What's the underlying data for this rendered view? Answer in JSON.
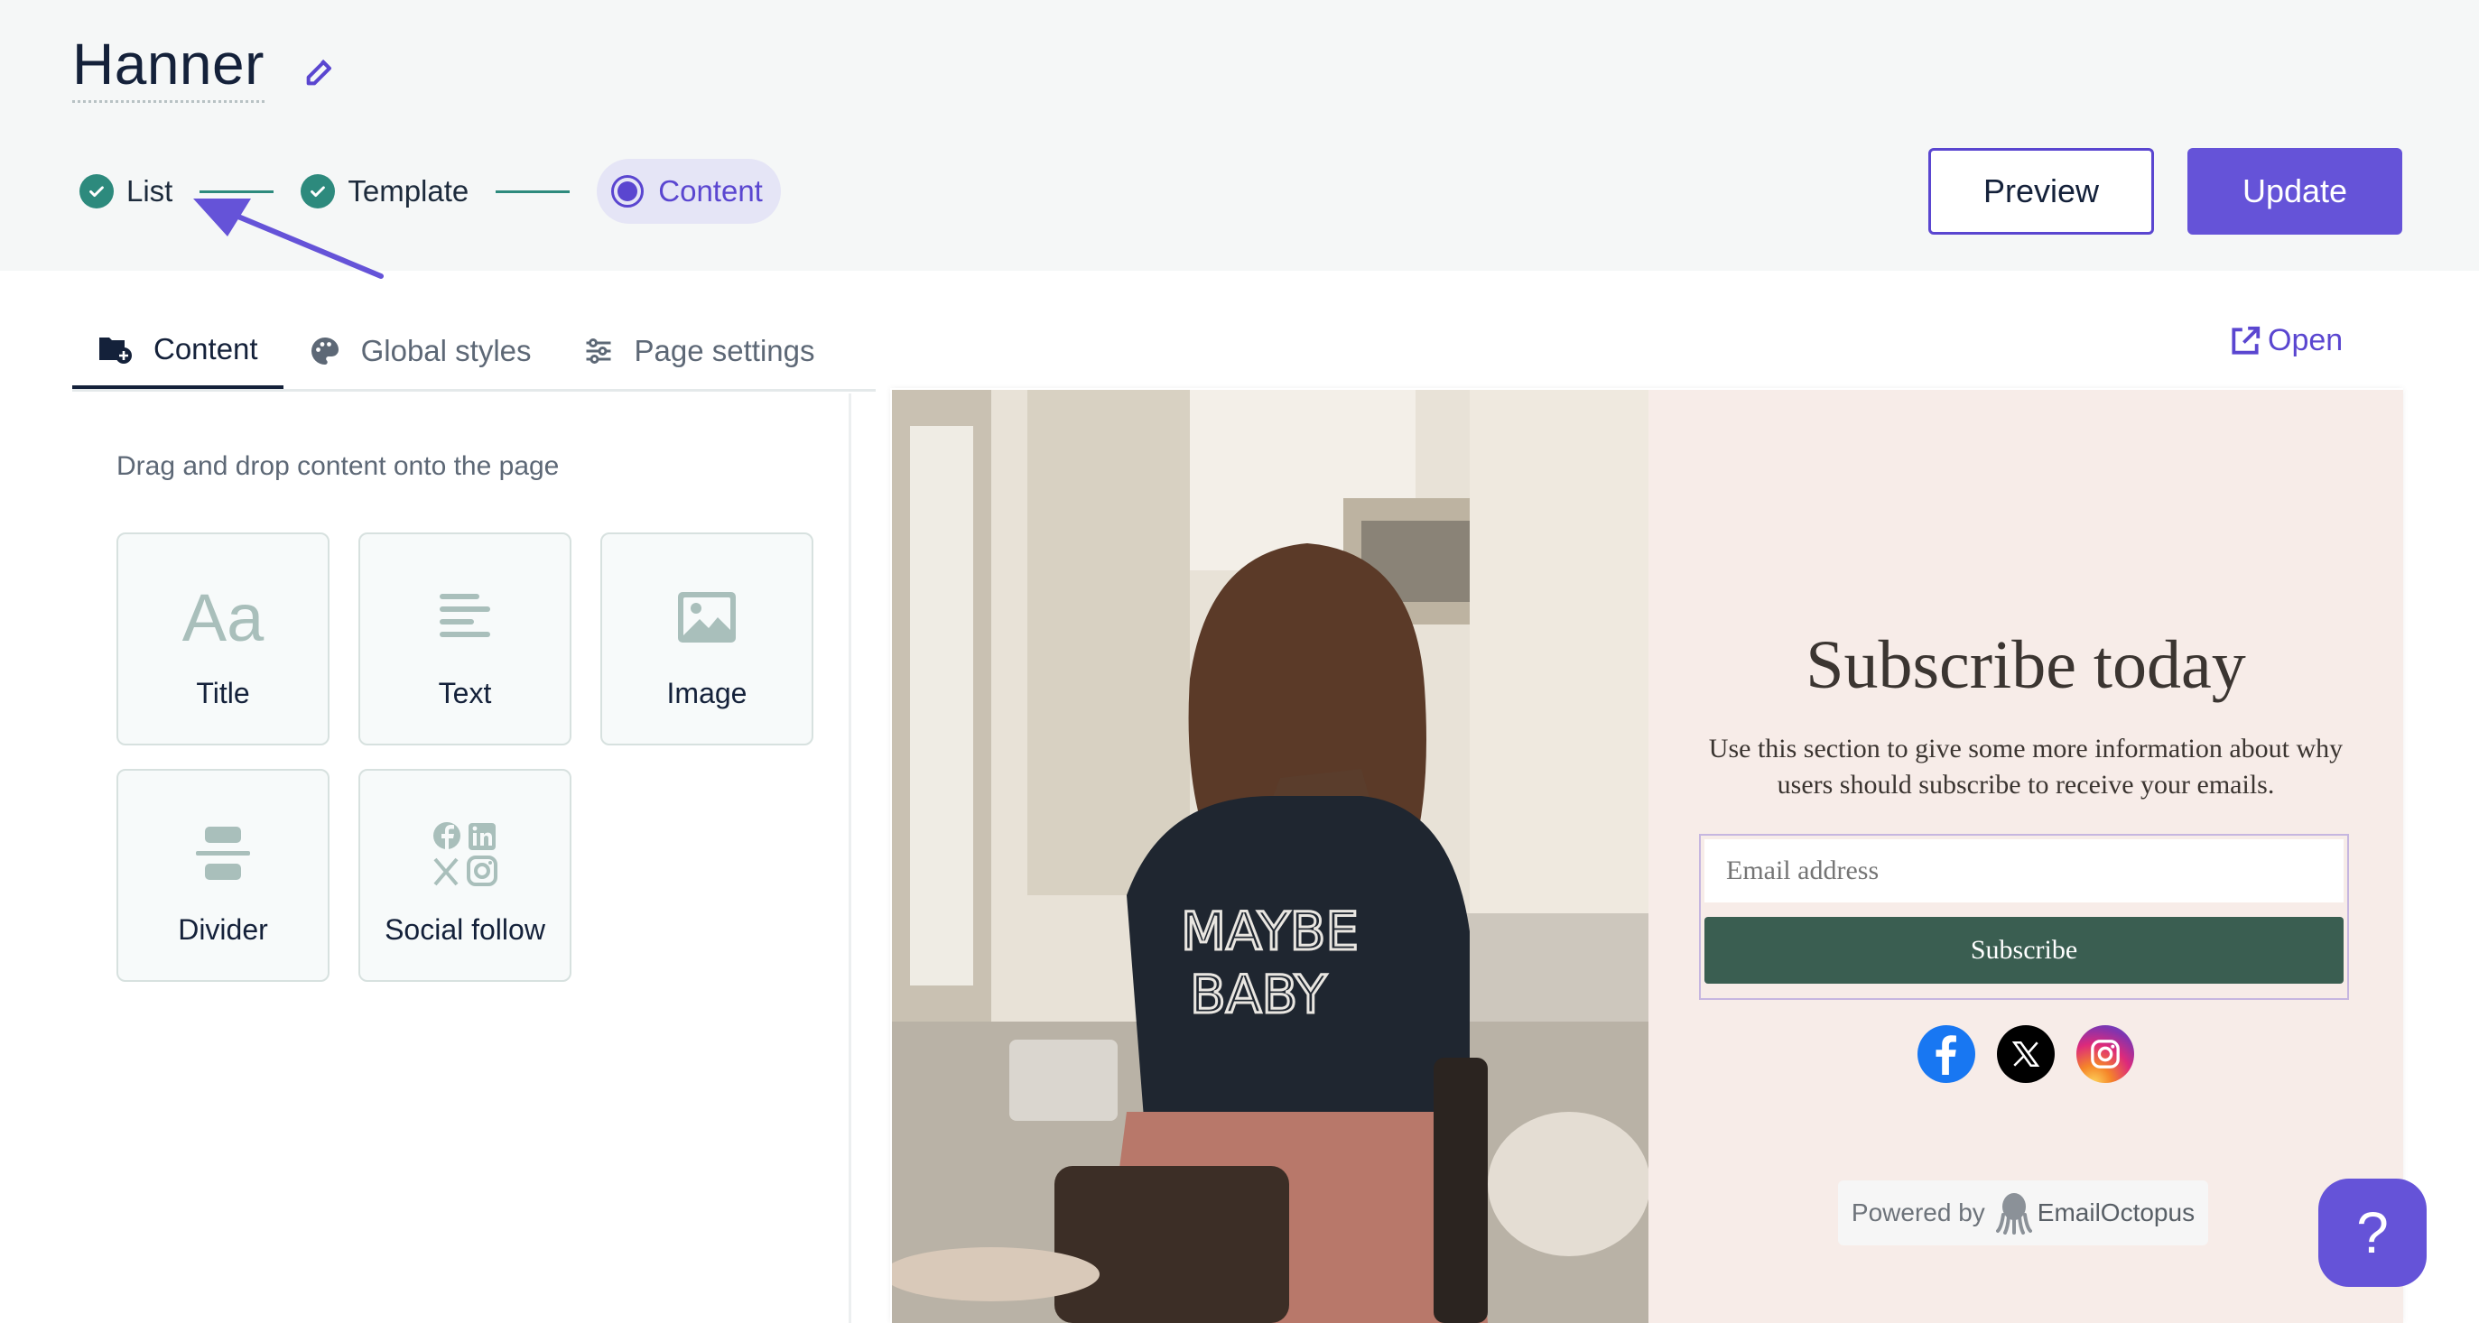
{
  "header": {
    "title": "Hanner",
    "edit_icon": "edit-icon"
  },
  "stepper": {
    "steps": [
      {
        "label": "List",
        "state": "done"
      },
      {
        "label": "Template",
        "state": "done"
      },
      {
        "label": "Content",
        "state": "active"
      }
    ]
  },
  "actions": {
    "preview_label": "Preview",
    "update_label": "Update"
  },
  "tabs": [
    {
      "label": "Content",
      "icon": "content-add-icon",
      "active": true
    },
    {
      "label": "Global styles",
      "icon": "palette-icon",
      "active": false
    },
    {
      "label": "Page settings",
      "icon": "sliders-icon",
      "active": false
    }
  ],
  "open_link": {
    "label": "Open",
    "icon": "external-link-icon"
  },
  "sidebar": {
    "hint": "Drag and drop content onto the page",
    "blocks": [
      {
        "label": "Title",
        "icon": "title-aa-icon"
      },
      {
        "label": "Text",
        "icon": "text-lines-icon"
      },
      {
        "label": "Image",
        "icon": "image-icon"
      },
      {
        "label": "Divider",
        "icon": "divider-icon"
      },
      {
        "label": "Social follow",
        "icon": "social-icons-icon"
      }
    ]
  },
  "preview": {
    "heading": "Subscribe today",
    "description": "Use this section to give some more information about why users should subscribe to receive your emails.",
    "email_placeholder": "Email address",
    "subscribe_label": "Subscribe",
    "social": [
      "facebook-icon",
      "x-icon",
      "instagram-icon"
    ],
    "powered_by": "Powered by",
    "brand": "EmailOctopus"
  },
  "help": {
    "label": "?"
  },
  "colors": {
    "accent": "#6553d8",
    "step_done": "#2d8a7d",
    "subscribe_button": "#3a5e51",
    "panel_bg": "#f7ece8"
  }
}
